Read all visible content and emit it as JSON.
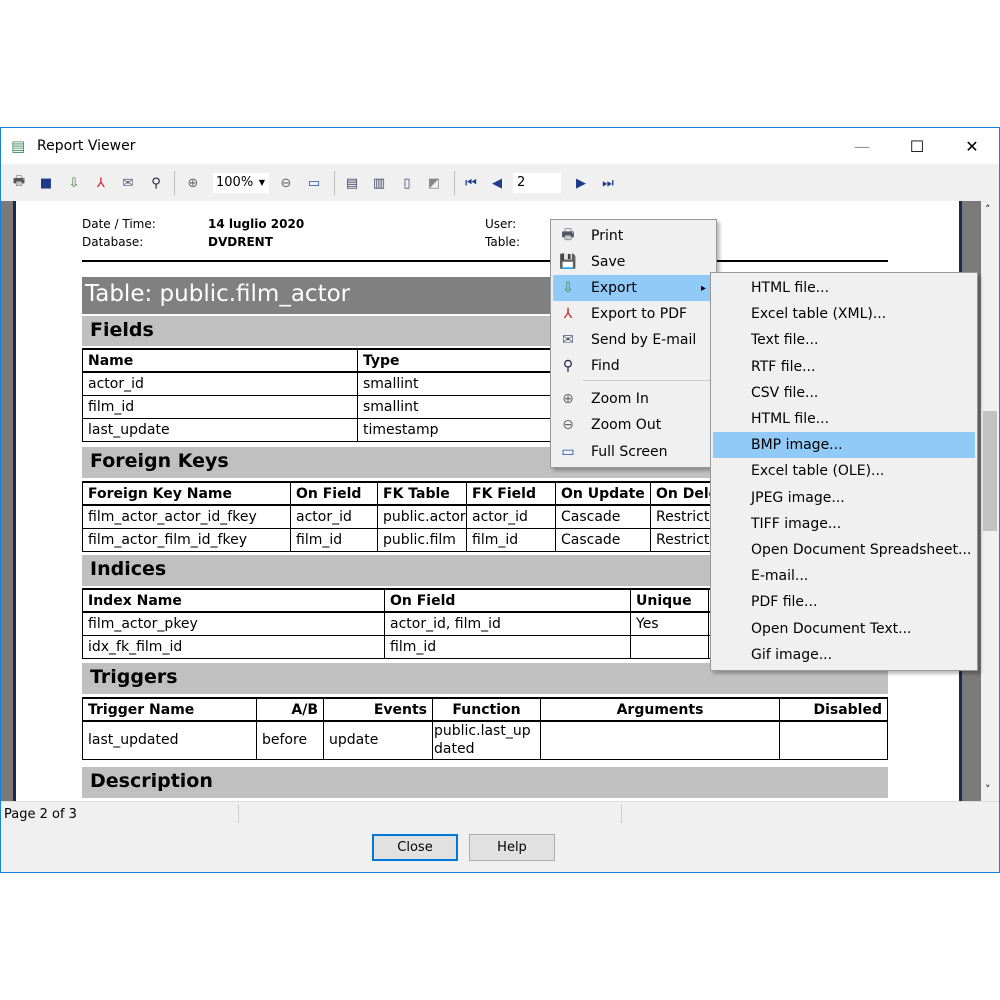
{
  "window": {
    "title": "Report Viewer",
    "minimize": "—",
    "maximize": "☐",
    "close": "✕"
  },
  "toolbar": {
    "zoom": "100%",
    "page": "2"
  },
  "report": {
    "date_label": "Date / Time:",
    "date_value": "14 luglio 2020",
    "db_label": "Database:",
    "db_value": "DVDRENT",
    "user_label": "User:",
    "table_label": "Table:",
    "table_title": "Table: public.film_actor",
    "fields": {
      "title": "Fields",
      "headers": [
        "Name",
        "Type"
      ],
      "rows": [
        [
          "actor_id",
          "smallint"
        ],
        [
          "film_id",
          "smallint"
        ],
        [
          "last_update",
          "timestamp"
        ]
      ]
    },
    "foreign_keys": {
      "title": "Foreign Keys",
      "headers": [
        "Foreign Key Name",
        "On Field",
        "FK Table",
        "FK Field",
        "On Update",
        "On Dele"
      ],
      "rows": [
        [
          "film_actor_actor_id_fkey",
          "actor_id",
          "public.actor",
          "actor_id",
          "Cascade",
          "Restrict"
        ],
        [
          "film_actor_film_id_fkey",
          "film_id",
          "public.film",
          "film_id",
          "Cascade",
          "Restrict"
        ]
      ]
    },
    "indices": {
      "title": "Indices",
      "headers": [
        "Index Name",
        "On Field",
        "Unique"
      ],
      "rows": [
        [
          "film_actor_pkey",
          "actor_id, film_id",
          "Yes"
        ],
        [
          "idx_fk_film_id",
          "film_id",
          ""
        ]
      ]
    },
    "triggers": {
      "title": "Triggers",
      "headers": [
        "Trigger Name",
        "A/B",
        "Events",
        "Function",
        "Arguments",
        "Disabled"
      ],
      "rows": [
        [
          "last_updated",
          "before",
          "update",
          "public.last_up dated",
          "",
          ""
        ]
      ]
    },
    "description": {
      "title": "Description"
    }
  },
  "status": {
    "page": "Page 2 of 3"
  },
  "buttons": {
    "close": "Close",
    "help": "Help"
  },
  "context_menu": {
    "items": [
      {
        "label": "Print",
        "icon": "printer-icon",
        "glyph": "🖶"
      },
      {
        "label": "Save",
        "icon": "save-icon",
        "glyph": "💾"
      },
      {
        "label": "Export",
        "icon": "export-icon",
        "glyph": "⇩",
        "submenu": true,
        "arrow": "▸"
      },
      {
        "label": "Export to PDF",
        "icon": "pdf-icon",
        "glyph": "⅄"
      },
      {
        "label": "Send by E-mail",
        "icon": "email-icon",
        "glyph": "✉"
      },
      {
        "label": "Find",
        "icon": "binoculars-icon",
        "glyph": "⚲"
      },
      {
        "label": "Zoom In",
        "icon": "zoom-in-icon",
        "glyph": "⊕"
      },
      {
        "label": "Zoom Out",
        "icon": "zoom-out-icon",
        "glyph": "⊖"
      },
      {
        "label": "Full Screen",
        "icon": "full-screen-icon",
        "glyph": "▭"
      }
    ]
  },
  "export_submenu": {
    "items": [
      "HTML file...",
      "Excel table (XML)...",
      "Text file...",
      "RTF file...",
      "CSV file...",
      "HTML file...",
      "BMP image...",
      "Excel table (OLE)...",
      "JPEG image...",
      "TIFF image...",
      "Open Document Spreadsheet...",
      "E-mail...",
      "PDF file...",
      "Open Document Text...",
      "Gif image..."
    ],
    "selected": "BMP image..."
  },
  "colors": {
    "highlight": "#91c9f7",
    "section": "#c0c0c0",
    "title_bar": "#808080"
  }
}
